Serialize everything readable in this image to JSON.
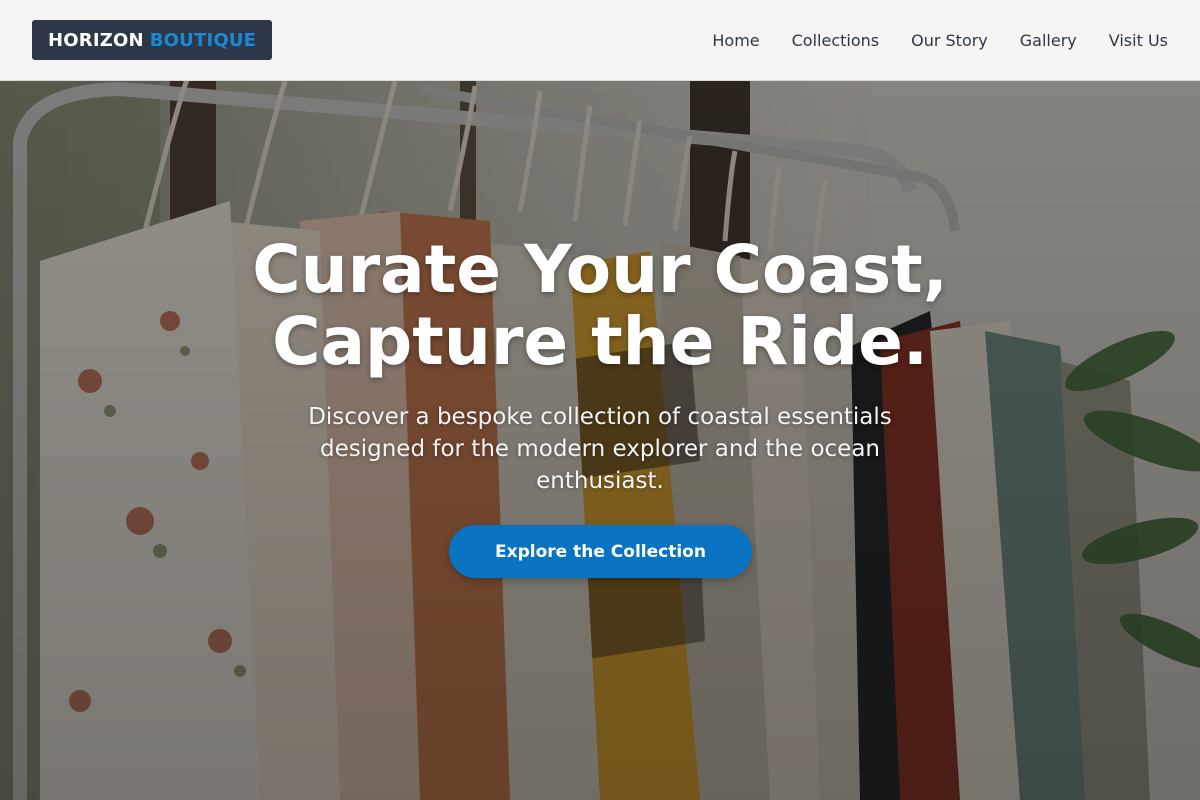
{
  "brand": {
    "name_primary": "HORIZON",
    "name_accent": "BOUTIQUE",
    "background_color": "#2d3748",
    "accent_color": "#1a8ad6"
  },
  "nav": {
    "items": [
      {
        "label": "Home"
      },
      {
        "label": "Collections"
      },
      {
        "label": "Our Story"
      },
      {
        "label": "Gallery"
      },
      {
        "label": "Visit Us"
      }
    ]
  },
  "hero": {
    "background_image": "clothing-rack-photo",
    "title_line1": "Curate Your Coast,",
    "title_line2": "Capture the Ride.",
    "subtitle": "Discover a bespoke collection of coastal essentials designed for the modern explorer and the ocean enthusiast.",
    "cta_label": "Explore the Collection",
    "cta_color": "#0a74c2"
  }
}
